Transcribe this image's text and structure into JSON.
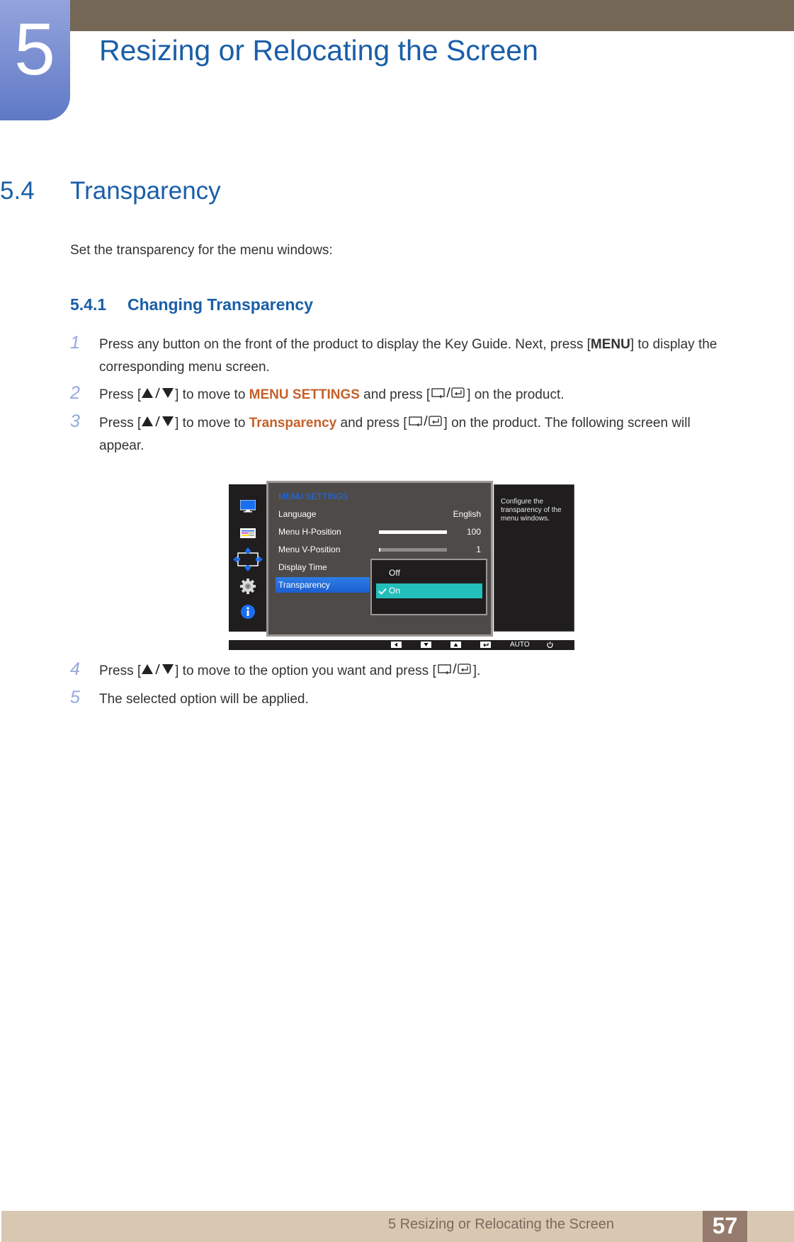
{
  "chapter": {
    "number": "5",
    "title": "Resizing or Relocating the Screen"
  },
  "section": {
    "number": "5.4",
    "title": "Transparency",
    "intro": "Set the transparency for the menu windows:"
  },
  "subsection": {
    "number": "5.4.1",
    "title": "Changing Transparency"
  },
  "steps": [
    {
      "num": "1",
      "parts": {
        "a": "Press any button on the front of the product to display the Key Guide. Next, press [",
        "key": "MENU",
        "b": "] to display the corresponding menu screen."
      }
    },
    {
      "num": "2",
      "parts": {
        "a": "Press [",
        "b": "] to move to ",
        "hl": "MENU SETTINGS",
        "c": " and press [",
        "d": "] on the product."
      }
    },
    {
      "num": "3",
      "parts": {
        "a": "Press [",
        "b": "] to move to ",
        "hl": "Transparency",
        "c": " and press [",
        "d": "] on the product. The following screen will appear."
      }
    },
    {
      "num": "4",
      "parts": {
        "a": "Press [",
        "b": "] to move to the option you want and press [",
        "c": "]."
      }
    },
    {
      "num": "5",
      "parts": {
        "a": "The selected option will be applied."
      }
    }
  ],
  "icons": {
    "up_down": "up-down-arrow-icon",
    "return_enter": "source-enter-icon"
  },
  "osd": {
    "menu_title": "MENU SETTINGS",
    "side_icons": [
      "picture-icon",
      "color-icon",
      "size-position-icon",
      "setup-gear-icon",
      "information-icon"
    ],
    "rows": [
      {
        "label": "Language",
        "value": "English"
      },
      {
        "label": "Menu H-Position",
        "value": "100",
        "slider": 1.0
      },
      {
        "label": "Menu V-Position",
        "value": "1",
        "slider": 0.01
      },
      {
        "label": "Display Time"
      },
      {
        "label": "Transparency",
        "selected": true
      }
    ],
    "dropdown": {
      "options": [
        {
          "label": "Off",
          "checked": false
        },
        {
          "label": "On",
          "checked": true
        }
      ]
    },
    "help_text": "Configure the transparency of the menu windows.",
    "keybar": [
      "left-key",
      "down-key",
      "up-key",
      "enter-key",
      "AUTO",
      "power-key"
    ],
    "keybar_auto": "AUTO"
  },
  "footer": {
    "text": "5 Resizing or Relocating the Screen",
    "page": "57"
  },
  "colors": {
    "heading_blue": "#1a5ea8",
    "highlight_orange": "#c5602a",
    "header_bar": "#756756",
    "footer_bar": "#d8c8b2",
    "page_box": "#957b6d",
    "osd_select_cyan": "#24bfbb"
  }
}
